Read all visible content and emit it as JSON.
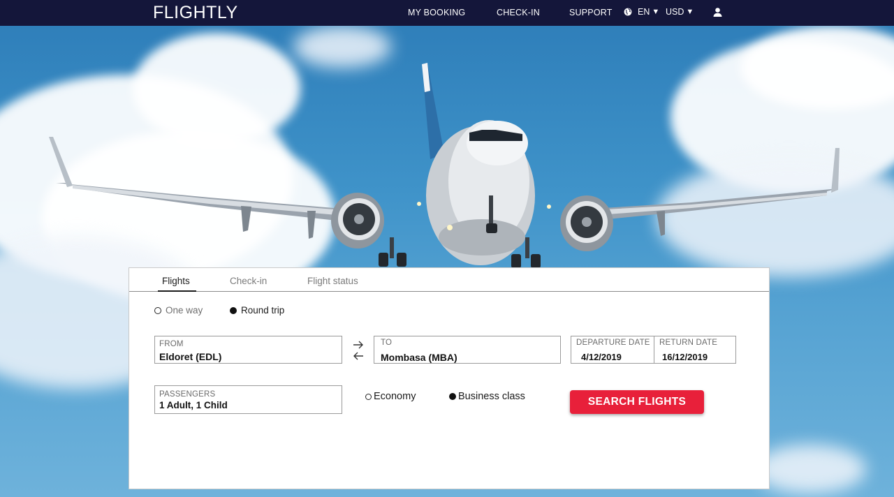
{
  "brand": {
    "logo": "FLIGHTLY"
  },
  "nav": {
    "my_booking": "MY BOOKING",
    "check_in": "CHECK-IN",
    "support": "SUPPORT",
    "language": "EN",
    "currency": "USD",
    "caret": "▼"
  },
  "tabs": [
    {
      "label": "Flights",
      "active": true
    },
    {
      "label": "Check-in",
      "active": false
    },
    {
      "label": "Flight status",
      "active": false
    }
  ],
  "trip_type": {
    "options": [
      {
        "label": "One way",
        "selected": false
      },
      {
        "label": "Round trip",
        "selected": true
      }
    ]
  },
  "from": {
    "label": "FROM",
    "value": "Eldoret (EDL)"
  },
  "to": {
    "label": "TO",
    "value": "Mombasa (MBA)"
  },
  "departure": {
    "label": "DEPARTURE DATE",
    "value": "4/12/2019"
  },
  "return": {
    "label": "RETURN DATE",
    "value": "16/12/2019"
  },
  "passengers": {
    "label": "PASSENGERS",
    "value": "1 Adult, 1 Child"
  },
  "cabin_class": {
    "options": [
      {
        "label": "Economy",
        "selected": false
      },
      {
        "label": "Business class",
        "selected": true
      }
    ]
  },
  "search_button": "SEARCH FLIGHTS",
  "colors": {
    "nav_background": "#14163a",
    "accent": "#e8203a",
    "sky": "#3b8cc4"
  },
  "icons": [
    "globe-icon",
    "user-icon",
    "swap-arrows-icon",
    "caret-down-icon"
  ]
}
